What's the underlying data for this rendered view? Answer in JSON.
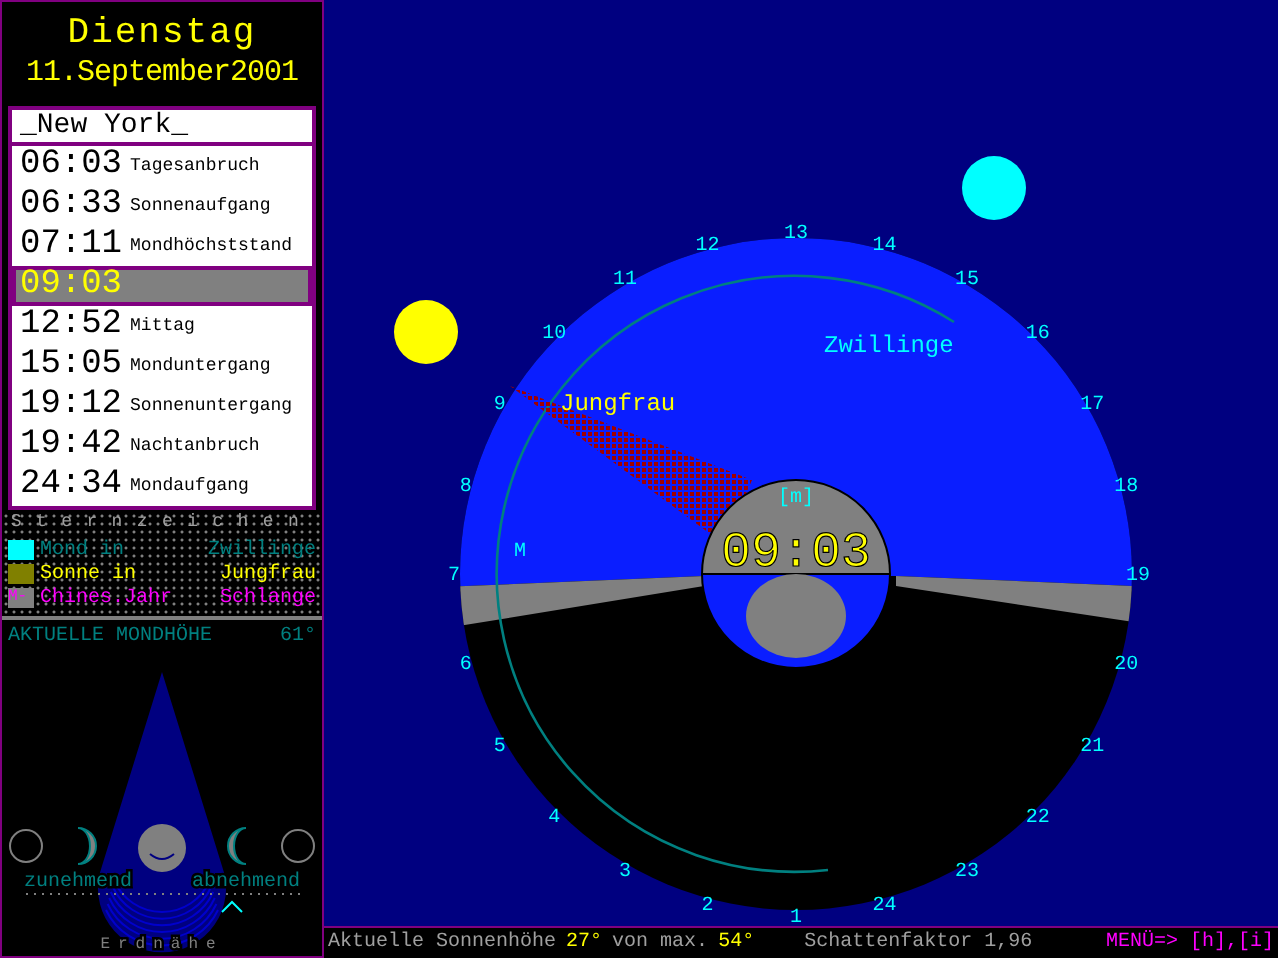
{
  "header": {
    "weekday": "Dienstag",
    "date": "11.September2001"
  },
  "location": "_New York_",
  "events": [
    {
      "time": "06:03",
      "label": "Tagesanbruch",
      "selected": false
    },
    {
      "time": "06:33",
      "label": "Sonnenaufgang",
      "selected": false
    },
    {
      "time": "07:11",
      "label": "Mondhöchststand",
      "selected": false
    },
    {
      "time": "09:03",
      "selected": true
    },
    {
      "time": "12:52",
      "label": "Mittag",
      "selected": false
    },
    {
      "time": "15:05",
      "label": "Monduntergang",
      "selected": false
    },
    {
      "time": "19:12",
      "label": "Sonnenuntergang",
      "selected": false
    },
    {
      "time": "19:42",
      "label": "Nachtanbruch",
      "selected": false
    },
    {
      "time": "24:34",
      "label": "Mondaufgang",
      "selected": false
    }
  ],
  "zodiac": {
    "title": "Sternzeichen",
    "rows": [
      {
        "kind": "moon",
        "label": "Mond in",
        "value": "Zwillinge",
        "color": "#00ffff"
      },
      {
        "kind": "sun",
        "label": "Sonne in",
        "value": "Jungfrau",
        "color": "#808000"
      },
      {
        "kind": "year",
        "label": "Chines.Jahr",
        "value": "Schlange",
        "color": "#808080",
        "swatch_text": "M-"
      }
    ]
  },
  "moon_height": {
    "label": "AKTUELLE MONDHÖHE",
    "value": "61°"
  },
  "phases": {
    "waxing": "zunehmend",
    "waning": "abnehmend",
    "caption": "Erdnähe"
  },
  "dial": {
    "hours": [
      "1",
      "2",
      "3",
      "4",
      "5",
      "6",
      "7",
      "8",
      "9",
      "10",
      "11",
      "12",
      "13",
      "14",
      "15",
      "16",
      "17",
      "18",
      "19",
      "20",
      "21",
      "22",
      "23",
      "24"
    ],
    "moon_sign": "Zwillinge",
    "sun_sign": "Jungfrau",
    "marker": "M",
    "clock_label": "[m]",
    "clock": "09:03"
  },
  "status": {
    "sun_label": "Aktuelle Sonnenhöhe",
    "sun_height": "27°",
    "max_label": "von max.",
    "max_height": "54°",
    "shadow": "Schattenfaktor 1,96",
    "menu": "MENÜ=> [h],[i]"
  }
}
